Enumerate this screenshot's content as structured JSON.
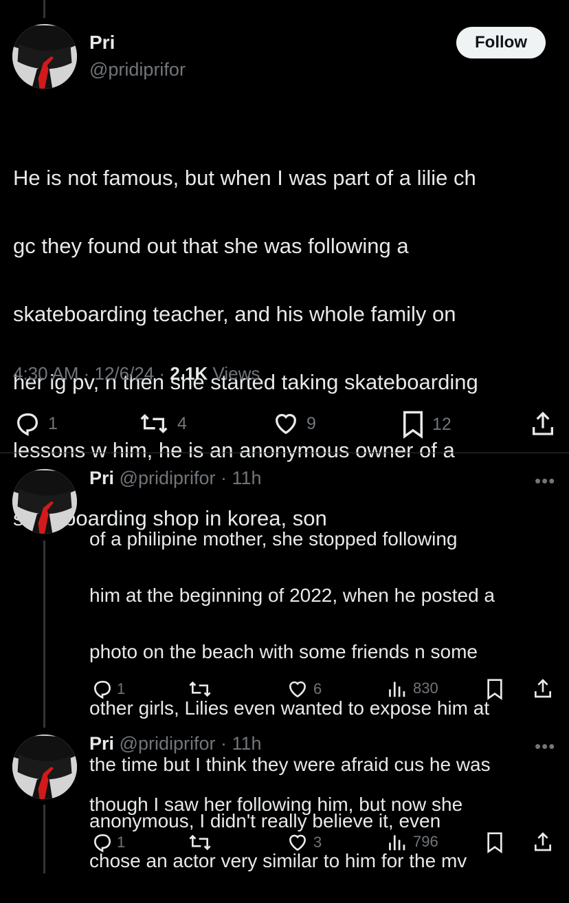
{
  "tweet": {
    "author_name": "Pri",
    "handle": "@pridiprifor",
    "follow_label": "Follow",
    "lines": [
      "He is not famous, but when I was part of a lilie ch",
      "gc they found out that she was following a",
      "skateboarding teacher, and his whole family on",
      "her ig pv, n then she started taking skateboarding",
      "lessons w him, he is an anonymous owner of a",
      "skateboarding shop in korea, son"
    ],
    "time": "4:30 AM",
    "date": "12/6/24",
    "views_count": "2.1K",
    "views_label": "Views",
    "replies": "1",
    "retweets": "4",
    "likes": "9",
    "bookmarks": "12"
  },
  "replies": [
    {
      "name": "Pri",
      "handle": "@pridiprifor",
      "age": "11h",
      "more": "•••",
      "lines": [
        "of a philipine mother, she stopped following",
        "him at the beginning of 2022, when he posted a",
        "photo on the beach with some friends n some",
        "other girls, Lilies even wanted to expose him at",
        "the time but I think they were afraid cus he was",
        "anonymous, I didn't really believe it, even"
      ],
      "replies": "1",
      "retweets": "",
      "likes": "6",
      "views": "830"
    },
    {
      "name": "Pri",
      "handle": "@pridiprifor",
      "age": "11h",
      "more": "•••",
      "lines": [
        "though I saw her following him, but now she",
        "chose an actor very similar to him for the mv"
      ],
      "replies": "1",
      "retweets": "",
      "likes": "3",
      "views": "796"
    }
  ],
  "icons": {
    "reply": "reply-icon",
    "retweet": "retweet-icon",
    "like": "heart-icon",
    "bookmark": "bookmark-icon",
    "share": "share-icon",
    "views": "views-icon"
  },
  "colors": {
    "background": "#000000",
    "text": "#e7e9ea",
    "secondary": "#71767b",
    "follow_bg": "#eff3f4"
  }
}
